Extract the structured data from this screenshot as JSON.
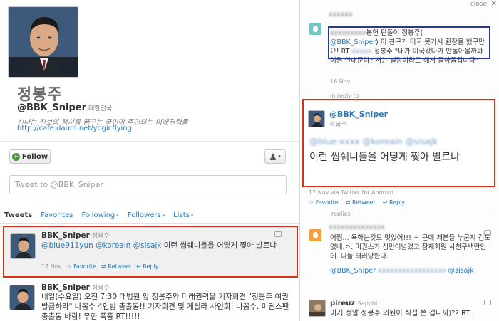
{
  "profile": {
    "name": "정봉주",
    "handle": "@BBK_Sniper",
    "location": "대한민국",
    "bio": "신나는 진보의 정치를 꿈꾸는 국민이 주인되는 미래권력들",
    "url": "http://cafe.daum.net/yogicflying"
  },
  "actions": {
    "follow_label": "Follow",
    "user_menu_icon": "person-icon"
  },
  "composer": {
    "placeholder": "Tweet to @BBK_Sniper"
  },
  "tabs": [
    {
      "label": "Tweets"
    },
    {
      "label": "Favorites"
    },
    {
      "label": "Following"
    },
    {
      "label": "Followers"
    },
    {
      "label": "Lists"
    }
  ],
  "tweets": [
    {
      "user": "BBK_Sniper",
      "display": "정봉주",
      "mentions": "@blue911yun @koreain @sisajk",
      "text": "이런 씹쉐니들을 어떻게 찢아 발르냐",
      "date": "17 Nov",
      "favorite": "Favorite",
      "retweet": "Retweet",
      "reply": "Reply"
    },
    {
      "user": "BBK_Sniper",
      "display": "정봉주",
      "text": "내일(수요일) 오전 7:30 대법원 앞 정봉주와 미래권력을 기자회견 \"정봉주 여권발급하라\" 나꼼수 4인방 총출동!! 기자회견 및 게릴라 사인회! 나꼼수. 미권스팬 총출동 바람! 무한 폭풍 RT!!!!!"
    }
  ],
  "detail": {
    "close_label": "close",
    "close_icon": "x-icon",
    "context_tweet": {
      "line1": "봉헌 탄돌이 정봉주(",
      "mention1": "@BBK_Sniper",
      "line2": ") 이 친구가 미국 못가서 환장을 했구만요! RT",
      "line3": "정봉주 \"내가 미국갔다가 안돌아올까봐 여권 안내준다? 저는 빌랑이라도 해서 돌아올겁니다\"",
      "date": "16 Nov",
      "reply_to": "in reply to"
    },
    "main_tweet": {
      "handle": "@BBK_Sniper",
      "display": "정봉주",
      "text": "이런 씹쉐니들을 어떻게 찢아 발르냐",
      "meta": "17 Nov via Twitter for Android",
      "favorite": "Favorite",
      "retweet": "Retweet",
      "reply": "Reply"
    },
    "replies_label": "replies",
    "reply1": {
      "text": "어쩜... 욕하는것도 멋있어!!! ㅋ 근데 저분들 누군지 검도없네.ㅇ. 미권스가 십만이넘었고 잠재회원 사천구백만인데. 니들 테러당한다.",
      "mention": "@BBK_Sniper",
      "mention_end": "@sisajk"
    },
    "reply2": {
      "user": "pireuz",
      "sub": "Sapphi",
      "text": "이거 정말 정봉주 의원이 직접 쓴 겁니까)?? RT"
    }
  }
}
